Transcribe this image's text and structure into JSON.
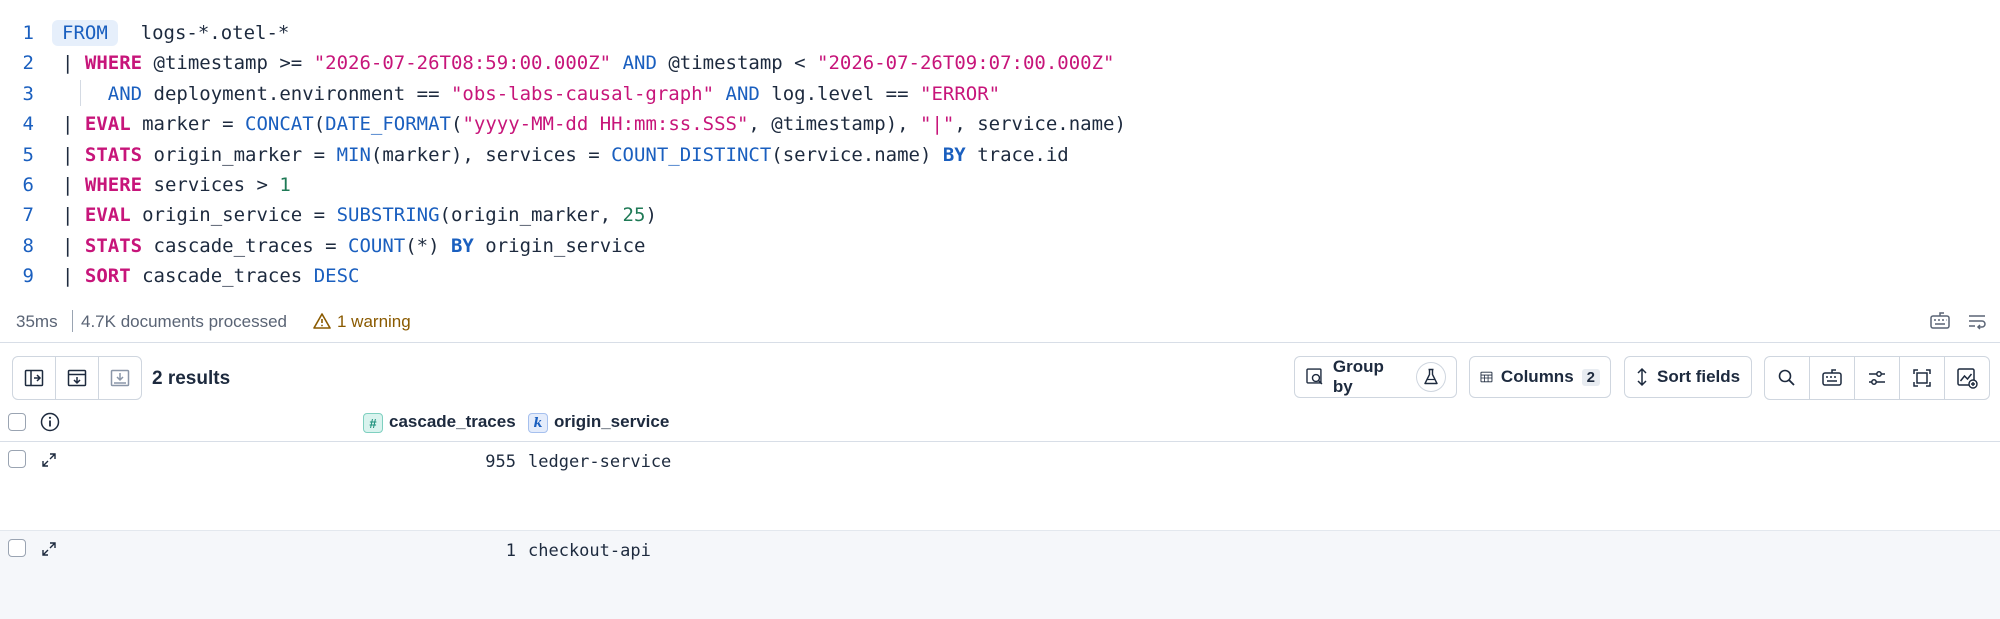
{
  "editor": {
    "lines": [
      {
        "n": "1",
        "tokens": [
          {
            "t": "FROM",
            "c": "from-pill"
          },
          {
            "t": "  logs-*.otel-*",
            "c": "plain"
          }
        ]
      },
      {
        "n": "2",
        "tokens": [
          {
            "t": "| ",
            "c": "plain"
          },
          {
            "t": "WHERE",
            "c": "kw-red"
          },
          {
            "t": " @timestamp >= ",
            "c": "plain"
          },
          {
            "t": "\"2026-07-26T08:59:00.000Z\"",
            "c": "str"
          },
          {
            "t": " ",
            "c": "plain"
          },
          {
            "t": "AND",
            "c": "kw-blue"
          },
          {
            "t": " @timestamp < ",
            "c": "plain"
          },
          {
            "t": "\"2026-07-26T09:07:00.000Z\"",
            "c": "str"
          }
        ]
      },
      {
        "n": "3",
        "tokens": [
          {
            "t": "    ",
            "c": "plain"
          },
          {
            "t": "AND",
            "c": "kw-blue"
          },
          {
            "t": " deployment.environment == ",
            "c": "plain"
          },
          {
            "t": "\"obs-labs-causal-graph\"",
            "c": "str"
          },
          {
            "t": " ",
            "c": "plain"
          },
          {
            "t": "AND",
            "c": "kw-blue"
          },
          {
            "t": " log.level == ",
            "c": "plain"
          },
          {
            "t": "\"ERROR\"",
            "c": "str"
          }
        ]
      },
      {
        "n": "4",
        "tokens": [
          {
            "t": "| ",
            "c": "plain"
          },
          {
            "t": "EVAL",
            "c": "kw-red"
          },
          {
            "t": " marker = ",
            "c": "plain"
          },
          {
            "t": "CONCAT",
            "c": "kw-blue"
          },
          {
            "t": "(",
            "c": "plain"
          },
          {
            "t": "DATE_FORMAT",
            "c": "kw-blue"
          },
          {
            "t": "(",
            "c": "plain"
          },
          {
            "t": "\"yyyy-MM-dd HH:mm:ss.SSS\"",
            "c": "str"
          },
          {
            "t": ", @timestamp), ",
            "c": "plain"
          },
          {
            "t": "\"|\"",
            "c": "str"
          },
          {
            "t": ", service.name)",
            "c": "plain"
          }
        ]
      },
      {
        "n": "5",
        "tokens": [
          {
            "t": "| ",
            "c": "plain"
          },
          {
            "t": "STATS",
            "c": "kw-red"
          },
          {
            "t": " origin_marker = ",
            "c": "plain"
          },
          {
            "t": "MIN",
            "c": "kw-blue"
          },
          {
            "t": "(marker), services = ",
            "c": "plain"
          },
          {
            "t": "COUNT_DISTINCT",
            "c": "kw-blue"
          },
          {
            "t": "(service.name) ",
            "c": "plain"
          },
          {
            "t": "BY",
            "c": "kw-blue-b"
          },
          {
            "t": " trace.id",
            "c": "plain"
          }
        ]
      },
      {
        "n": "6",
        "tokens": [
          {
            "t": "| ",
            "c": "plain"
          },
          {
            "t": "WHERE",
            "c": "kw-red"
          },
          {
            "t": " services > ",
            "c": "plain"
          },
          {
            "t": "1",
            "c": "num"
          }
        ]
      },
      {
        "n": "7",
        "tokens": [
          {
            "t": "| ",
            "c": "plain"
          },
          {
            "t": "EVAL",
            "c": "kw-red"
          },
          {
            "t": " origin_service = ",
            "c": "plain"
          },
          {
            "t": "SUBSTRING",
            "c": "kw-blue"
          },
          {
            "t": "(origin_marker, ",
            "c": "plain"
          },
          {
            "t": "25",
            "c": "num"
          },
          {
            "t": ")",
            "c": "plain"
          }
        ]
      },
      {
        "n": "8",
        "tokens": [
          {
            "t": "| ",
            "c": "plain"
          },
          {
            "t": "STATS",
            "c": "kw-red"
          },
          {
            "t": " cascade_traces = ",
            "c": "plain"
          },
          {
            "t": "COUNT",
            "c": "kw-blue"
          },
          {
            "t": "(*) ",
            "c": "plain"
          },
          {
            "t": "BY",
            "c": "kw-blue-b"
          },
          {
            "t": " origin_service",
            "c": "plain"
          }
        ]
      },
      {
        "n": "9",
        "tokens": [
          {
            "t": "| ",
            "c": "plain"
          },
          {
            "t": "SORT",
            "c": "kw-red"
          },
          {
            "t": " cascade_traces ",
            "c": "plain"
          },
          {
            "t": "DESC",
            "c": "kw-blue"
          }
        ]
      }
    ]
  },
  "status": {
    "timing": "35ms",
    "documents": "4.7K documents processed",
    "warning": "1 warning"
  },
  "toolbar": {
    "results": "2 results",
    "group_by": "Group by",
    "columns": "Columns",
    "columns_count": "2",
    "sort_fields": "Sort fields"
  },
  "table": {
    "columns": [
      {
        "name": "cascade_traces",
        "type": "#"
      },
      {
        "name": "origin_service",
        "type": "k"
      }
    ],
    "rows": [
      {
        "cascade_traces": "955",
        "origin_service": "ledger-service"
      },
      {
        "cascade_traces": "1",
        "origin_service": "checkout-api"
      }
    ]
  },
  "colors": {
    "keyword_red": "#c7157a",
    "keyword_blue": "#1a5fbf",
    "number_green": "#1f7a56",
    "warning": "#8a5a00",
    "row_alt": "#f5f7fa"
  }
}
